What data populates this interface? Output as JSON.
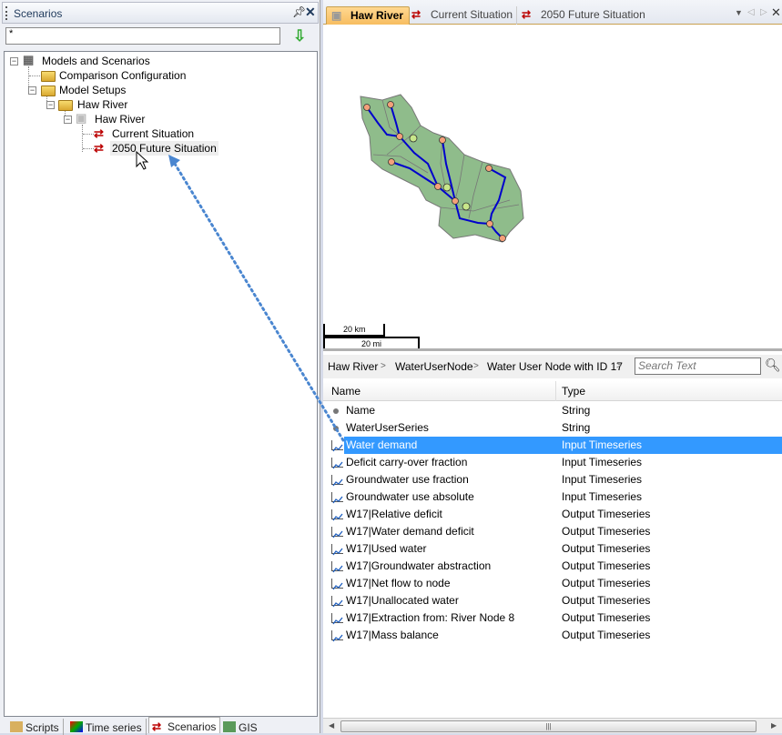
{
  "left_panel": {
    "title": "Scenarios",
    "search_value": "*",
    "tree": [
      {
        "label": "Models and Scenarios",
        "icon": "database-scenario-icon"
      },
      {
        "label": "Comparison Configuration",
        "icon": "folder-icon"
      },
      {
        "label": "Model Setups",
        "icon": "folder-icon"
      },
      {
        "label": "Haw River",
        "icon": "folder-icon"
      },
      {
        "label": "Haw River",
        "icon": "model-block-icon"
      },
      {
        "label": "Current Situation",
        "icon": "scenario-icon"
      },
      {
        "label": "2050 Future Situation",
        "icon": "scenario-icon",
        "hovered": true
      }
    ],
    "bottom_tabs": [
      {
        "label": "Scripts",
        "icon": "scroll-icon"
      },
      {
        "label": "Time series",
        "icon": "chart-icon"
      },
      {
        "label": "Scenarios",
        "icon": "scenario-icon",
        "active": true
      },
      {
        "label": "GIS",
        "icon": "layers-icon"
      }
    ]
  },
  "doc_tabs": [
    {
      "label": "Haw River",
      "active": true,
      "icon": "model-block-icon"
    },
    {
      "label": "Current Situation",
      "icon": "scenario-icon"
    },
    {
      "label": "2050 Future Situation",
      "icon": "scenario-icon"
    }
  ],
  "map": {
    "scale_km": "20 km",
    "scale_mi": "20 mi",
    "colors": {
      "basin": "#8fbc8b",
      "river": "#0000cc",
      "node": "#f4a07a",
      "water_user": "#c8e68a"
    }
  },
  "breadcrumb": [
    "Haw River",
    "WaterUserNode",
    "Water User Node with ID 17"
  ],
  "search_placeholder": "Search Text",
  "table": {
    "headers": [
      "Name",
      "Type"
    ],
    "rows": [
      {
        "name": "Name",
        "type": "String",
        "icon": "dot"
      },
      {
        "name": "WaterUserSeries",
        "type": "String",
        "icon": "dot"
      },
      {
        "name": "Water demand",
        "type": "Input Timeseries",
        "icon": "timeseries",
        "selected": true
      },
      {
        "name": "Deficit carry-over fraction",
        "type": "Input Timeseries",
        "icon": "timeseries"
      },
      {
        "name": "Groundwater use fraction",
        "type": "Input Timeseries",
        "icon": "timeseries"
      },
      {
        "name": "Groundwater use absolute",
        "type": "Input Timeseries",
        "icon": "timeseries"
      },
      {
        "name": "W17|Relative deficit",
        "type": "Output Timeseries",
        "icon": "timeseries"
      },
      {
        "name": "W17|Water demand deficit",
        "type": "Output Timeseries",
        "icon": "timeseries"
      },
      {
        "name": "W17|Used water",
        "type": "Output Timeseries",
        "icon": "timeseries"
      },
      {
        "name": "W17|Groundwater abstraction",
        "type": "Output Timeseries",
        "icon": "timeseries"
      },
      {
        "name": "W17|Net flow to node",
        "type": "Output Timeseries",
        "icon": "timeseries"
      },
      {
        "name": "W17|Unallocated water",
        "type": "Output Timeseries",
        "icon": "timeseries"
      },
      {
        "name": "W17|Extraction from:  River Node 8",
        "type": "Output Timeseries",
        "icon": "timeseries"
      },
      {
        "name": "W17|Mass balance",
        "type": "Output Timeseries",
        "icon": "timeseries"
      }
    ]
  },
  "accent": "#3399ff"
}
